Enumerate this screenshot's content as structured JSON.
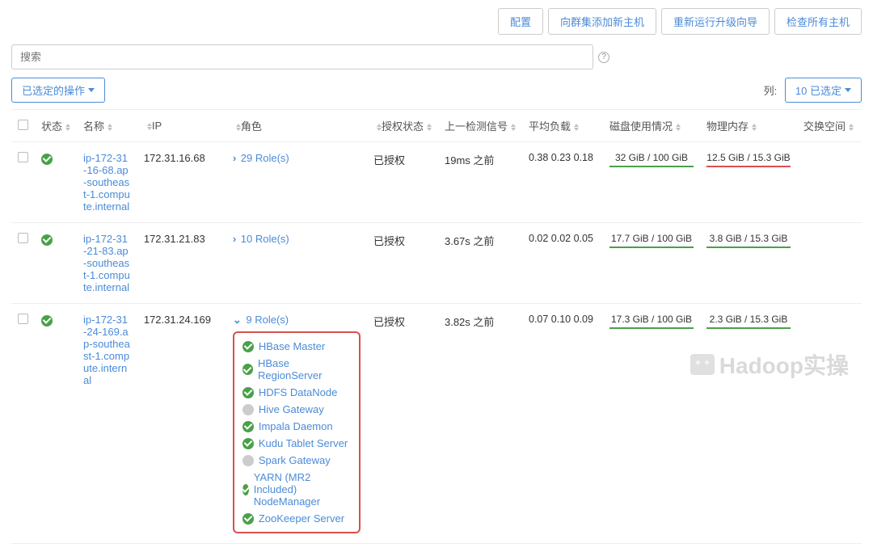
{
  "top_actions": {
    "configure": "配置",
    "add_host": "向群集添加新主机",
    "rerun_upgrade": "重新运行升级向导",
    "inspect_all": "检查所有主机"
  },
  "search": {
    "placeholder": "搜索"
  },
  "toolbar": {
    "selected_actions": "已选定的操作",
    "columns_label": "列:",
    "columns_selected": "10 已选定"
  },
  "columns": {
    "status": "状态",
    "name": "名称",
    "ip": "IP",
    "roles": "角色",
    "auth": "授权状态",
    "last_signal": "上一检测信号",
    "load_avg": "平均负载",
    "disk_usage": "磁盘使用情况",
    "physical_mem": "物理内存",
    "swap": "交换空间"
  },
  "rows": [
    {
      "name": "ip-172-31-16-68.ap-southeast-1.compute.internal",
      "ip": "172.31.16.68",
      "roles_label": "29 Role(s)",
      "expanded": false,
      "auth": "已授权",
      "last_signal": "19ms 之前",
      "load": "0.38 0.23 0.18",
      "disk": "32 GiB / 100 GiB",
      "disk_warn": false,
      "mem": "12.5 GiB / 15.3 GiB",
      "mem_warn": true
    },
    {
      "name": "ip-172-31-21-83.ap-southeast-1.compute.internal",
      "ip": "172.31.21.83",
      "roles_label": "10 Role(s)",
      "expanded": false,
      "auth": "已授权",
      "last_signal": "3.67s 之前",
      "load": "0.02 0.02 0.05",
      "disk": "17.7 GiB / 100 GiB",
      "disk_warn": false,
      "mem": "3.8 GiB / 15.3 GiB",
      "mem_warn": false
    },
    {
      "name": "ip-172-31-24-169.ap-southeast-1.compute.internal",
      "ip": "172.31.24.169",
      "roles_label": "9 Role(s)",
      "expanded": true,
      "auth": "已授权",
      "last_signal": "3.82s 之前",
      "load": "0.07 0.10 0.09",
      "disk": "17.3 GiB / 100 GiB",
      "disk_warn": false,
      "mem": "2.3 GiB / 15.3 GiB",
      "mem_warn": false,
      "role_items": [
        {
          "name": "HBase Master",
          "status": "ok"
        },
        {
          "name": "HBase RegionServer",
          "status": "ok"
        },
        {
          "name": "HDFS DataNode",
          "status": "ok"
        },
        {
          "name": "Hive Gateway",
          "status": "off"
        },
        {
          "name": "Impala Daemon",
          "status": "ok"
        },
        {
          "name": "Kudu Tablet Server",
          "status": "ok"
        },
        {
          "name": "Spark Gateway",
          "status": "off"
        },
        {
          "name": "YARN (MR2 Included) NodeManager",
          "status": "ok"
        },
        {
          "name": "ZooKeeper Server",
          "status": "ok"
        }
      ]
    }
  ],
  "watermark": "Hadoop实操"
}
